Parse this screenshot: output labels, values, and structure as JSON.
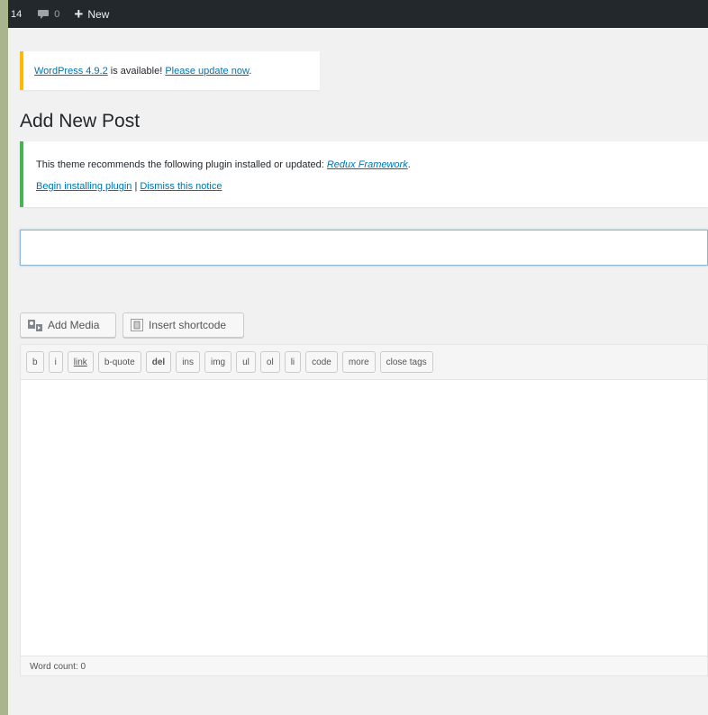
{
  "adminbar": {
    "updates_count": "14",
    "comments_count": "0",
    "new_label": "New"
  },
  "update_nag": {
    "version_link": "WordPress 4.9.2",
    "middle_text": " is available! ",
    "update_link": "Please update now",
    "end_text": "."
  },
  "page_title": "Add New Post",
  "theme_notice": {
    "text": "This theme recommends the following plugin installed or updated: ",
    "plugin_link": "Redux Framework",
    "end_text": ".",
    "install_link": "Begin installing plugin",
    "separator": " | ",
    "dismiss_link": "Dismiss this notice"
  },
  "title_input": {
    "value": ""
  },
  "media_buttons": {
    "add_media": "Add Media",
    "insert_shortcode": "Insert shortcode"
  },
  "quicktags": [
    "b",
    "i",
    "link",
    "b-quote",
    "del",
    "ins",
    "img",
    "ul",
    "ol",
    "li",
    "code",
    "more",
    "close tags"
  ],
  "status_bar": {
    "word_count": "Word count: 0"
  },
  "colors": {
    "adminbar_bg": "#23282d",
    "link": "#0073aa",
    "update_nag_border": "#ffba00",
    "success_border": "#46b450"
  }
}
